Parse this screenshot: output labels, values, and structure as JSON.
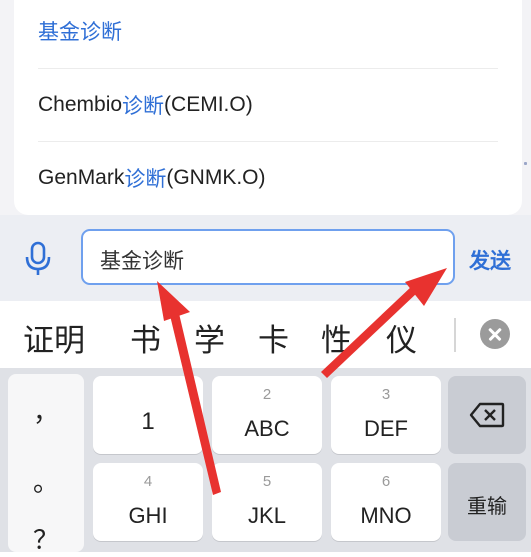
{
  "suggestions": [
    {
      "prefix": "",
      "highlight": "基金诊断",
      "suffix": ""
    },
    {
      "prefix": "Chembio",
      "highlight": "诊断",
      "suffix": "(CEMI.O)"
    },
    {
      "prefix": "GenMark",
      "highlight": "诊断",
      "suffix": "(GNMK.O)"
    }
  ],
  "input": {
    "value": "基金诊断",
    "send_label": "发送"
  },
  "candidates": [
    "证明",
    "书",
    "学",
    "卡",
    "性",
    "仪"
  ],
  "keyboard": {
    "punctuation": [
      "，",
      "。",
      "？"
    ],
    "keys": [
      {
        "num": "",
        "label": "1"
      },
      {
        "num": "2",
        "label": "ABC"
      },
      {
        "num": "3",
        "label": "DEF"
      },
      {
        "num": "4",
        "label": "GHI"
      },
      {
        "num": "5",
        "label": "JKL"
      },
      {
        "num": "6",
        "label": "MNO"
      }
    ],
    "reenter_label": "重输"
  },
  "colors": {
    "accent": "#2f6fd6",
    "arrow": "#e8322f"
  },
  "icons": [
    "microphone-icon",
    "close-circle-icon",
    "backspace-icon"
  ]
}
